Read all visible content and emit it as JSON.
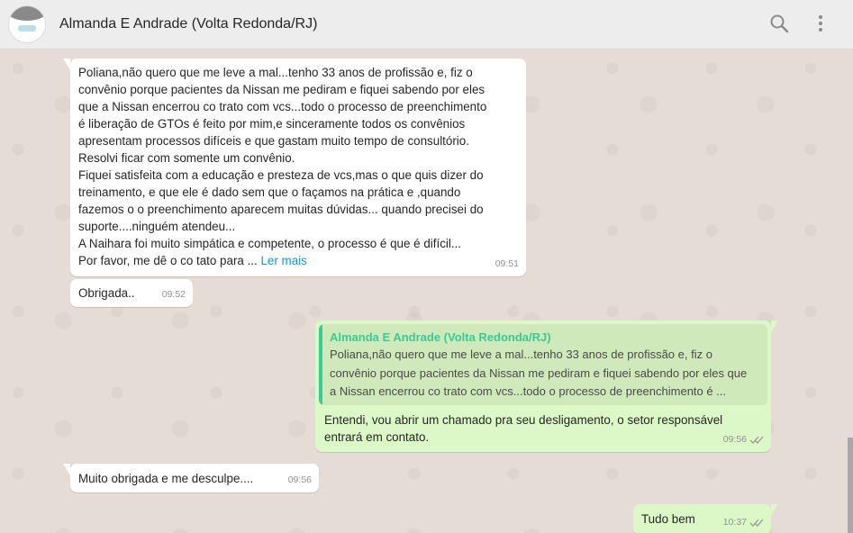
{
  "header": {
    "contact_name": "Almanda E Andrade (Volta Redonda/RJ)",
    "icons": [
      "search-icon",
      "menu-icon"
    ]
  },
  "colors": {
    "chat_bg": "#e5ddd5",
    "incoming": "#ffffff",
    "outgoing": "#dcf8c6",
    "quote_name": "#35cd96",
    "link": "#039be5"
  },
  "messages": [
    {
      "direction": "incoming",
      "lines": [
        "Poliana,não quero que me leve a mal...tenho 33 anos  de profissão e, fiz o",
        "convênio porque pacientes da Nissan me pediram e fiquei sabendo por eles",
        "que a Nissan encerrou co trato com vcs...todo o processo de preenchimento",
        "é liberação de GTOs é  feito por mim,e sinceramente  todos os convênios",
        "apresentam processos difíceis e que gastam  muito tempo de consultório.",
        "Resolvi ficar com somente um convênio.",
        "Fiquei satisfeita com a educação  e presteza  de vcs,mas o que quis dizer do",
        "treinamento, e que ele é  dado sem que o façamos na prática e ,quando",
        "fazemos o o preenchimento  aparecem muitas dúvidas... quando precisei do",
        "suporte....ninguém atendeu...",
        "A Naihara  foi muito simpática  e competente, o processo é que é  difícil...",
        "Por favor, me dê  o co tato para ..."
      ],
      "read_more": "Ler mais",
      "time": "09:51"
    },
    {
      "direction": "incoming",
      "text": "Obrigada..",
      "time": "09:52"
    },
    {
      "direction": "outgoing",
      "quote_author": "Almanda E Andrade (Volta Redonda/RJ)",
      "quote_lines": [
        "Poliana,não quero que me leve a mal...tenho 33 anos  de profissão e, fiz o",
        "convênio porque pacientes da Nissan me pediram e fiquei sabendo por eles  que",
        "a Nissan encerrou co trato com vcs...todo o processo de preenchimento  é ..."
      ],
      "lines": [
        "Entendi, vou abrir um chamado pra seu desligamento, o setor responsável",
        "entrará em contato."
      ],
      "time": "09:56",
      "status": "read-ticks"
    },
    {
      "direction": "incoming",
      "text": "Muito obrigada e me desculpe....",
      "time": "09:56"
    },
    {
      "direction": "outgoing",
      "text": "Tudo bem",
      "time": "10:37",
      "status": "read-ticks"
    }
  ]
}
